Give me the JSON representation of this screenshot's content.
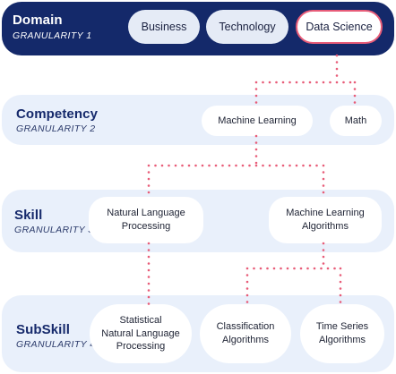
{
  "levels": [
    {
      "title": "Domain",
      "subtitle": "GRANULARITY 1"
    },
    {
      "title": "Competency",
      "subtitle": "GRANULARITY 2"
    },
    {
      "title": "Skill",
      "subtitle": "GRANULARITY 3"
    },
    {
      "title": "SubSkill",
      "subtitle": "GRANULARITY 4"
    }
  ],
  "domain": {
    "business": "Business",
    "technology": "Technology",
    "data_science": "Data Science"
  },
  "competency": {
    "machine_learning": "Machine Learning",
    "math": "Math"
  },
  "skill": {
    "nlp": "Natural Language\nProcessing",
    "ml_algorithms": "Machine Learning\nAlgorithms"
  },
  "subskill": {
    "statistical_nlp": "Statistical\nNatural Language\nProcessing",
    "classification": "Classification\nAlgorithms",
    "time_series": "Time Series\nAlgorithms"
  },
  "colors": {
    "dark_band": "#14296a",
    "light_band": "#e9f0fb",
    "connector": "#e85c78",
    "highlight_border": "#e85c78"
  }
}
